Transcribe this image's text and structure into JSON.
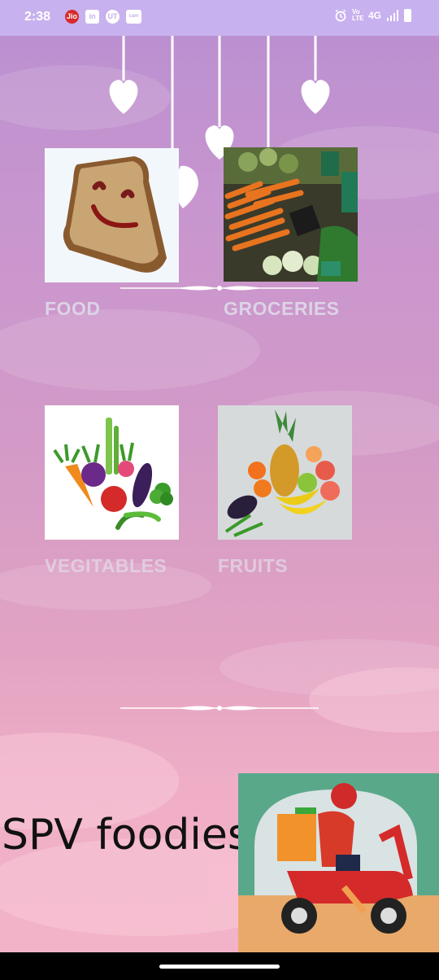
{
  "status_bar": {
    "time": "2:38",
    "left_icons": [
      "Jio",
      "in",
      "UT",
      "cam"
    ],
    "network": "4G",
    "volte": "Vo LTE"
  },
  "categories": [
    {
      "id": "food",
      "label": "FOOD",
      "image": "bread-smiley-image"
    },
    {
      "id": "groceries",
      "label": "GROCERIES",
      "image": "market-vegetables-image"
    },
    {
      "id": "vegetables",
      "label": "VEGITABLES",
      "image": "vegetables-image"
    },
    {
      "id": "fruits",
      "label": "FRUITS",
      "image": "fruits-image"
    }
  ],
  "brand": {
    "name": "SPV foodies"
  },
  "colors": {
    "status_bar_bg": "#c8b1ef",
    "label_text": "#dcd3e6",
    "brand_text": "#111111",
    "nav_bar": "#000000"
  }
}
